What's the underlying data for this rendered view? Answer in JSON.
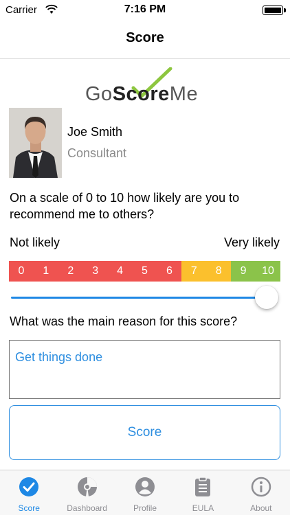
{
  "status_bar": {
    "carrier": "Carrier",
    "time": "7:16 PM"
  },
  "nav": {
    "title": "Score"
  },
  "logo": {
    "go": "Go",
    "score": "Score",
    "me": "Me",
    "accent": "#8dc63f"
  },
  "profile": {
    "name": "Joe Smith",
    "role": "Consultant"
  },
  "question": "On a scale of 0 to 10 how likely are you to recommend me to others?",
  "scale": {
    "low_label": "Not likely",
    "high_label": "Very likely",
    "cells": [
      {
        "label": "0",
        "color": "#ef5350"
      },
      {
        "label": "1",
        "color": "#ef5350"
      },
      {
        "label": "2",
        "color": "#ef5350"
      },
      {
        "label": "3",
        "color": "#ef5350"
      },
      {
        "label": "4",
        "color": "#ef5350"
      },
      {
        "label": "5",
        "color": "#ef5350"
      },
      {
        "label": "6",
        "color": "#ef5350"
      },
      {
        "label": "7",
        "color": "#fbc02d"
      },
      {
        "label": "8",
        "color": "#fbc02d"
      },
      {
        "label": "9",
        "color": "#8bc34a"
      },
      {
        "label": "10",
        "color": "#8bc34a"
      }
    ]
  },
  "slider": {
    "value": 10,
    "min": 0,
    "max": 10,
    "color": "#1e88e5"
  },
  "reason": {
    "question": "What was the main reason for this score?",
    "value": "Get things done"
  },
  "score_button": {
    "label": "Score"
  },
  "tabs": [
    {
      "label": "Score",
      "icon": "check-circle-icon",
      "active": true
    },
    {
      "label": "Dashboard",
      "icon": "dashboard-pie-icon",
      "active": false
    },
    {
      "label": "Profile",
      "icon": "profile-person-icon",
      "active": false
    },
    {
      "label": "EULA",
      "icon": "clipboard-icon",
      "active": false
    },
    {
      "label": "About",
      "icon": "info-icon",
      "active": false
    }
  ]
}
